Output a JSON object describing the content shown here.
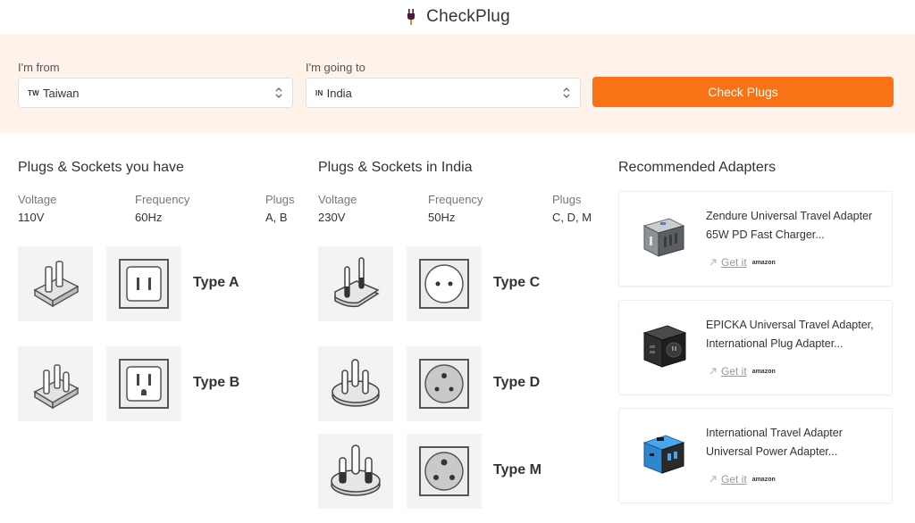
{
  "app": {
    "name": "CheckPlug",
    "logo_icon": "plug-icon"
  },
  "search": {
    "from_label": "I'm from",
    "from_code": "TW",
    "from_value": "Taiwan",
    "to_label": "I'm going to",
    "to_code": "IN",
    "to_value": "India",
    "button_label": "Check Plugs"
  },
  "have": {
    "title": "Plugs & Sockets you have",
    "voltage_label": "Voltage",
    "voltage": "110V",
    "frequency_label": "Frequency",
    "frequency": "60Hz",
    "plugs_label": "Plugs",
    "plugs": "A, B",
    "types": [
      {
        "label": "Type A",
        "plug_icon": "type-a-plug-icon",
        "socket_icon": "type-a-socket-icon"
      },
      {
        "label": "Type B",
        "plug_icon": "type-b-plug-icon",
        "socket_icon": "type-b-socket-icon"
      }
    ]
  },
  "dest": {
    "title": "Plugs & Sockets in India",
    "voltage_label": "Voltage",
    "voltage": "230V",
    "frequency_label": "Frequency",
    "frequency": "50Hz",
    "plugs_label": "Plugs",
    "plugs": "C, D, M",
    "types": [
      {
        "label": "Type C",
        "plug_icon": "type-c-plug-icon",
        "socket_icon": "type-c-socket-icon"
      },
      {
        "label": "Type D",
        "plug_icon": "type-d-plug-icon",
        "socket_icon": "type-d-socket-icon"
      },
      {
        "label": "Type M",
        "plug_icon": "type-m-plug-icon",
        "socket_icon": "type-m-socket-icon"
      }
    ]
  },
  "adapters": {
    "title": "Recommended Adapters",
    "items": [
      {
        "title_line1": "Zendure Universal Travel Adapter",
        "title_line2": "65W PD Fast Charger...",
        "link": "Get it",
        "store": "amazon",
        "image_icon": "gray-adapter-icon"
      },
      {
        "title_line1": "EPICKA Universal Travel Adapter,",
        "title_line2": "International Plug Adapter...",
        "link": "Get it",
        "store": "amazon",
        "image_icon": "black-adapter-icon"
      },
      {
        "title_line1": "International Travel Adapter",
        "title_line2": "Universal Power Adapter...",
        "link": "Get it",
        "store": "amazon",
        "image_icon": "blue-adapter-icon"
      }
    ]
  },
  "colors": {
    "accent": "#f97316",
    "band": "#fdf3ea",
    "tile": "#f3f3f3"
  }
}
